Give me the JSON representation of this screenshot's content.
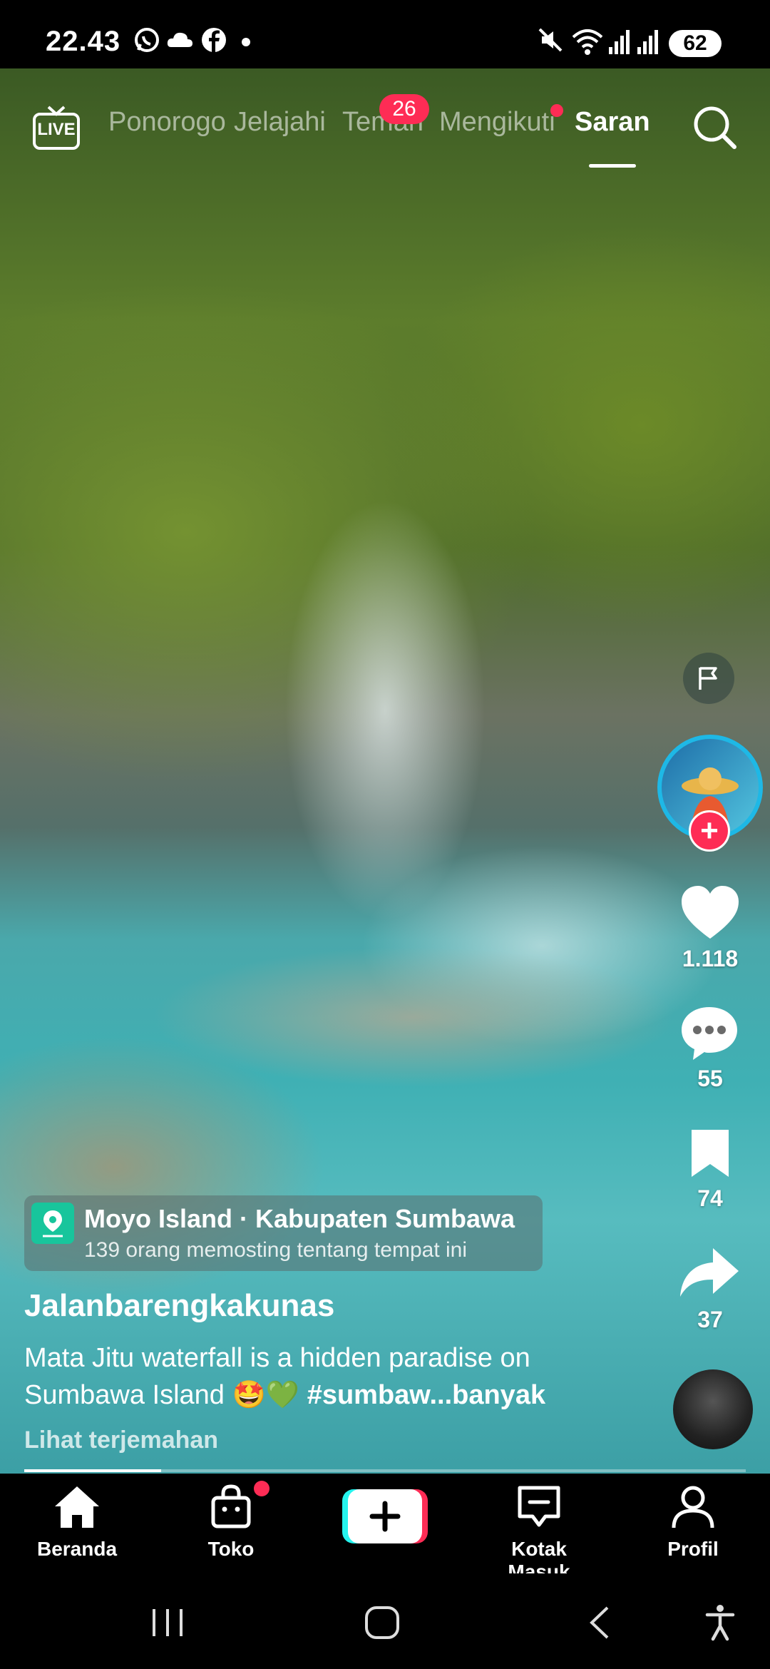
{
  "status_bar": {
    "time": "22.43",
    "battery": "62"
  },
  "top_nav": {
    "live_label": "LIVE",
    "tabs": [
      {
        "label": "Ponorogo"
      },
      {
        "label": "Jelajahi"
      },
      {
        "label": "Teman"
      },
      {
        "label": "Mengikuti"
      },
      {
        "label": "Saran"
      }
    ],
    "active_tab": "Saran",
    "teman_badge": "26"
  },
  "actions": {
    "likes": "1.118",
    "comments": "55",
    "saves": "74",
    "shares": "37"
  },
  "location": {
    "title": "Moyo Island · Kabupaten Sumbawa",
    "subtitle": "139 orang memosting tentang tempat ini"
  },
  "post": {
    "username": "Jalanbarengkakunas",
    "caption_text": "Mata Jitu waterfall is a hidden paradise on Sumbawa Island 🤩💚 ",
    "caption_tag": "#sumbaw...banyak",
    "translate": "Lihat terjemahan",
    "progress_fraction": 0.19
  },
  "bottom_nav": {
    "items": [
      {
        "label": "Beranda",
        "icon": "home-icon"
      },
      {
        "label": "Toko",
        "icon": "shop-bag-icon"
      },
      {
        "label": "",
        "icon": "create-plus-icon"
      },
      {
        "label": "Kotak Masuk",
        "icon": "inbox-icon"
      },
      {
        "label": "Profil",
        "icon": "profile-icon"
      }
    ]
  },
  "colors": {
    "accent": "#fe2c55",
    "location_icon": "#18c59c"
  }
}
